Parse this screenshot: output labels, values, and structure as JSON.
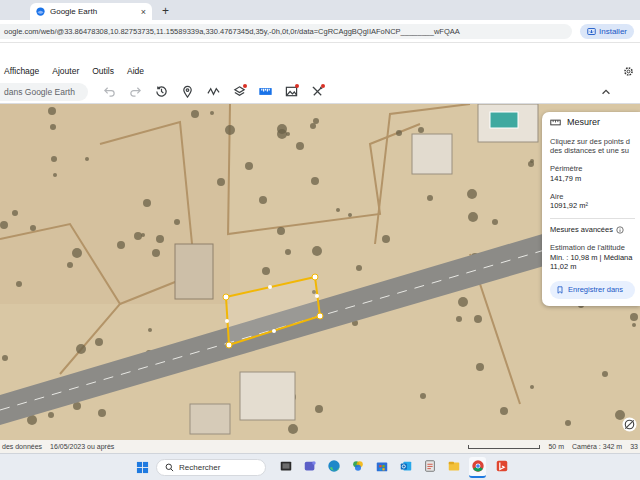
{
  "browser": {
    "tabs": [
      {
        "label": "Google Earth",
        "selected": true
      }
    ],
    "tab_close": "×",
    "new_tab": "+",
    "address": "oogle.com/web/@33.86478308,10.82753735,11.15589339a,330.4767345d,35y,-0h,0t,0r/data=CgRCAggBQgIIAFoNCP________wFQAA",
    "install_button": "Installer"
  },
  "menu": [
    "Affichage",
    "Ajouter",
    "Outils",
    "Aide"
  ],
  "toolbar": {
    "search_placeholder": "dans Google Earth",
    "tools": [
      {
        "kind": "undo",
        "active": false,
        "disabled": true,
        "dot": false
      },
      {
        "kind": "redo",
        "active": false,
        "disabled": true,
        "dot": false
      },
      {
        "kind": "history",
        "active": false,
        "disabled": false,
        "dot": false
      },
      {
        "kind": "pin",
        "active": false,
        "disabled": false,
        "dot": false
      },
      {
        "kind": "path",
        "active": false,
        "disabled": false,
        "dot": false
      },
      {
        "kind": "layers",
        "active": false,
        "disabled": false,
        "dot": true
      },
      {
        "kind": "ruler",
        "active": true,
        "disabled": false,
        "dot": false
      },
      {
        "kind": "image",
        "active": false,
        "disabled": false,
        "dot": true
      },
      {
        "kind": "tools",
        "active": false,
        "disabled": false,
        "dot": true
      }
    ]
  },
  "measure_panel": {
    "title": "Mesurer",
    "hint": "Cliquez sur des points d",
    "hint_2": "des distances et une su",
    "perimeter_label": "Périmètre",
    "perimeter": "141,79 m",
    "area_label": "Aire",
    "area": "1091,92 m²",
    "advanced": "Mesures avancées",
    "altitude_label": "Estimation de l'altitude",
    "altitude": "Min. : 10,98 m | Médiana",
    "altitude_max": "11,02 m",
    "save_button": "Enregistrer dans"
  },
  "status_bar": {
    "source": "des données",
    "date": "16/05/2023 ou après",
    "scale": "50 m",
    "camera": "Caméra : 342 m",
    "coords": "33"
  },
  "taskbar": {
    "search_placeholder": "Rechercher",
    "apps": [
      {
        "kind": "taskview",
        "active": false
      },
      {
        "kind": "teams",
        "active": false
      },
      {
        "kind": "edge",
        "active": false
      },
      {
        "kind": "photos",
        "active": false
      },
      {
        "kind": "store",
        "active": false
      },
      {
        "kind": "outlook",
        "active": false
      },
      {
        "kind": "tablet",
        "active": false
      },
      {
        "kind": "files",
        "active": false
      },
      {
        "kind": "chrome",
        "active": true
      },
      {
        "kind": "bing",
        "active": false
      }
    ]
  }
}
